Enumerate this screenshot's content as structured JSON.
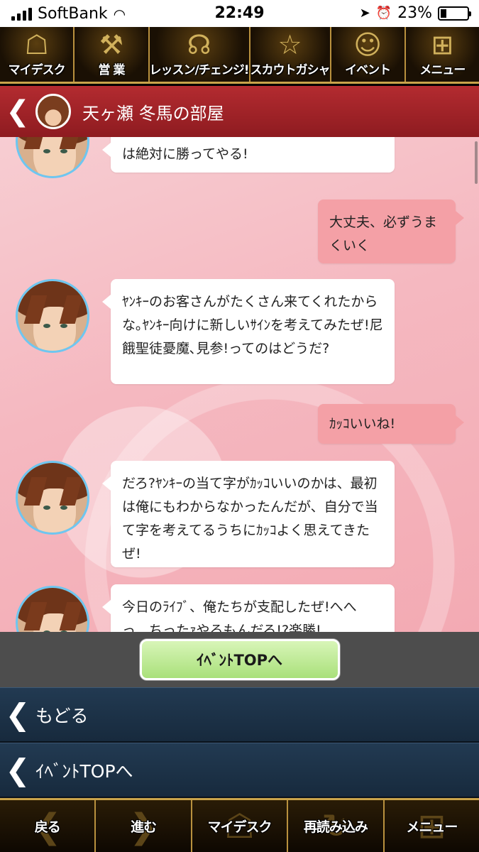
{
  "status": {
    "carrier": "SoftBank",
    "time": "22:49",
    "battery": "23%",
    "battery_level": 0.23
  },
  "topnav": {
    "items": [
      {
        "label": "マイデスク",
        "icon": "chair-icon"
      },
      {
        "label": "営 業",
        "icon": "microphone-icon"
      },
      {
        "label": "レッスン/チェンジ!",
        "icon": "headphones-icon"
      },
      {
        "label": "スカウトガシャ",
        "icon": "star-icon"
      },
      {
        "label": "イベント",
        "icon": "event-icon"
      },
      {
        "label": "メニュー",
        "icon": "grid-menu-icon"
      }
    ]
  },
  "room": {
    "title": "天ヶ瀬 冬馬の部屋"
  },
  "messages": [
    {
      "side": "left",
      "text": "は絶対に勝ってやる!"
    },
    {
      "side": "right",
      "text": "大丈夫、必ずうまくいく"
    },
    {
      "side": "left",
      "text": "ﾔﾝｷｰのお客さんがたくさん来てくれたからな｡ﾔﾝｷｰ向けに新しいｻｲﾝを考えてみたぜ!尼餓聖徒憂魔､見参!ってのはどうだ?"
    },
    {
      "side": "right",
      "text": "ｶｯｺいいね!"
    },
    {
      "side": "left",
      "text": "だろ?ﾔﾝｷｰの当て字がｶｯｺいいのかは、最初は俺にもわからなかったんだが、自分で当て字を考えてるうちにｶｯｺよく思えてきたぜ!"
    },
    {
      "side": "left",
      "text": "今日のﾗｲﾌﾞ、俺たちが支配したぜ!へへっ、ちったｧやるもんだろ!?楽勝!"
    }
  ],
  "event_button": {
    "label": "ｲﾍﾞﾝﾄTOPへ"
  },
  "listnav": {
    "back_label": "もどる",
    "event_top_label": "ｲﾍﾞﾝﾄTOPへ"
  },
  "bottombar": {
    "items": [
      {
        "label": "戻る",
        "icon": "back-arrow-icon"
      },
      {
        "label": "進む",
        "icon": "forward-arrow-icon"
      },
      {
        "label": "マイデスク",
        "icon": "chair-icon"
      },
      {
        "label": "再読み込み",
        "icon": "reload-icon"
      },
      {
        "label": "メニュー",
        "icon": "grid-menu-icon"
      }
    ]
  }
}
